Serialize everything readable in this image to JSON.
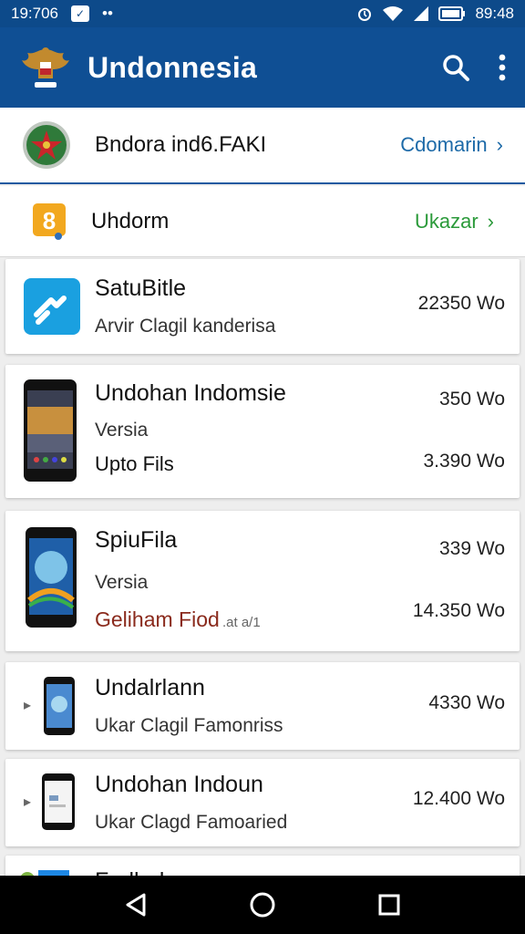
{
  "status_bar": {
    "time": "19:706",
    "right_time": "89:48",
    "dots": "••"
  },
  "app_bar": {
    "title": "Undonnesia"
  },
  "header_rows": [
    {
      "label": "Bndora ind6.FAKI",
      "link": "Cdomarin",
      "link_color": "#1d6aa8"
    },
    {
      "label": "Uhdorm",
      "link": "Ukazar",
      "link_color": "#2b9a3a"
    }
  ],
  "apps": [
    {
      "name": "SatuBitle",
      "subtitle": "Arvir Clagil kanderisa",
      "size": "22350 Wo"
    },
    {
      "name": "Undohan Indomsie",
      "version_label": "Versia",
      "detail": "Upto Fils",
      "size_top": "350 Wo",
      "size_bottom": "3.390 Wo"
    },
    {
      "name": "SpiuFila",
      "version_label": "Versia",
      "detail": "Geliham Fiod",
      "detail_small": ".at a/1",
      "detail_color": "#8a2a1c",
      "size_top": "339 Wo",
      "size_bottom": "14.350 Wo"
    },
    {
      "name": "Undalrlann",
      "subtitle": "Ukar Clagil Famonriss",
      "size": "4330 Wo"
    },
    {
      "name": "Undohan Indoun",
      "subtitle": "Ukar Clagd Famoaried",
      "size": "12.400 Wo"
    },
    {
      "name": "Frulled"
    }
  ],
  "colors": {
    "primary": "#0f4f94",
    "status": "#0d4a8a"
  }
}
